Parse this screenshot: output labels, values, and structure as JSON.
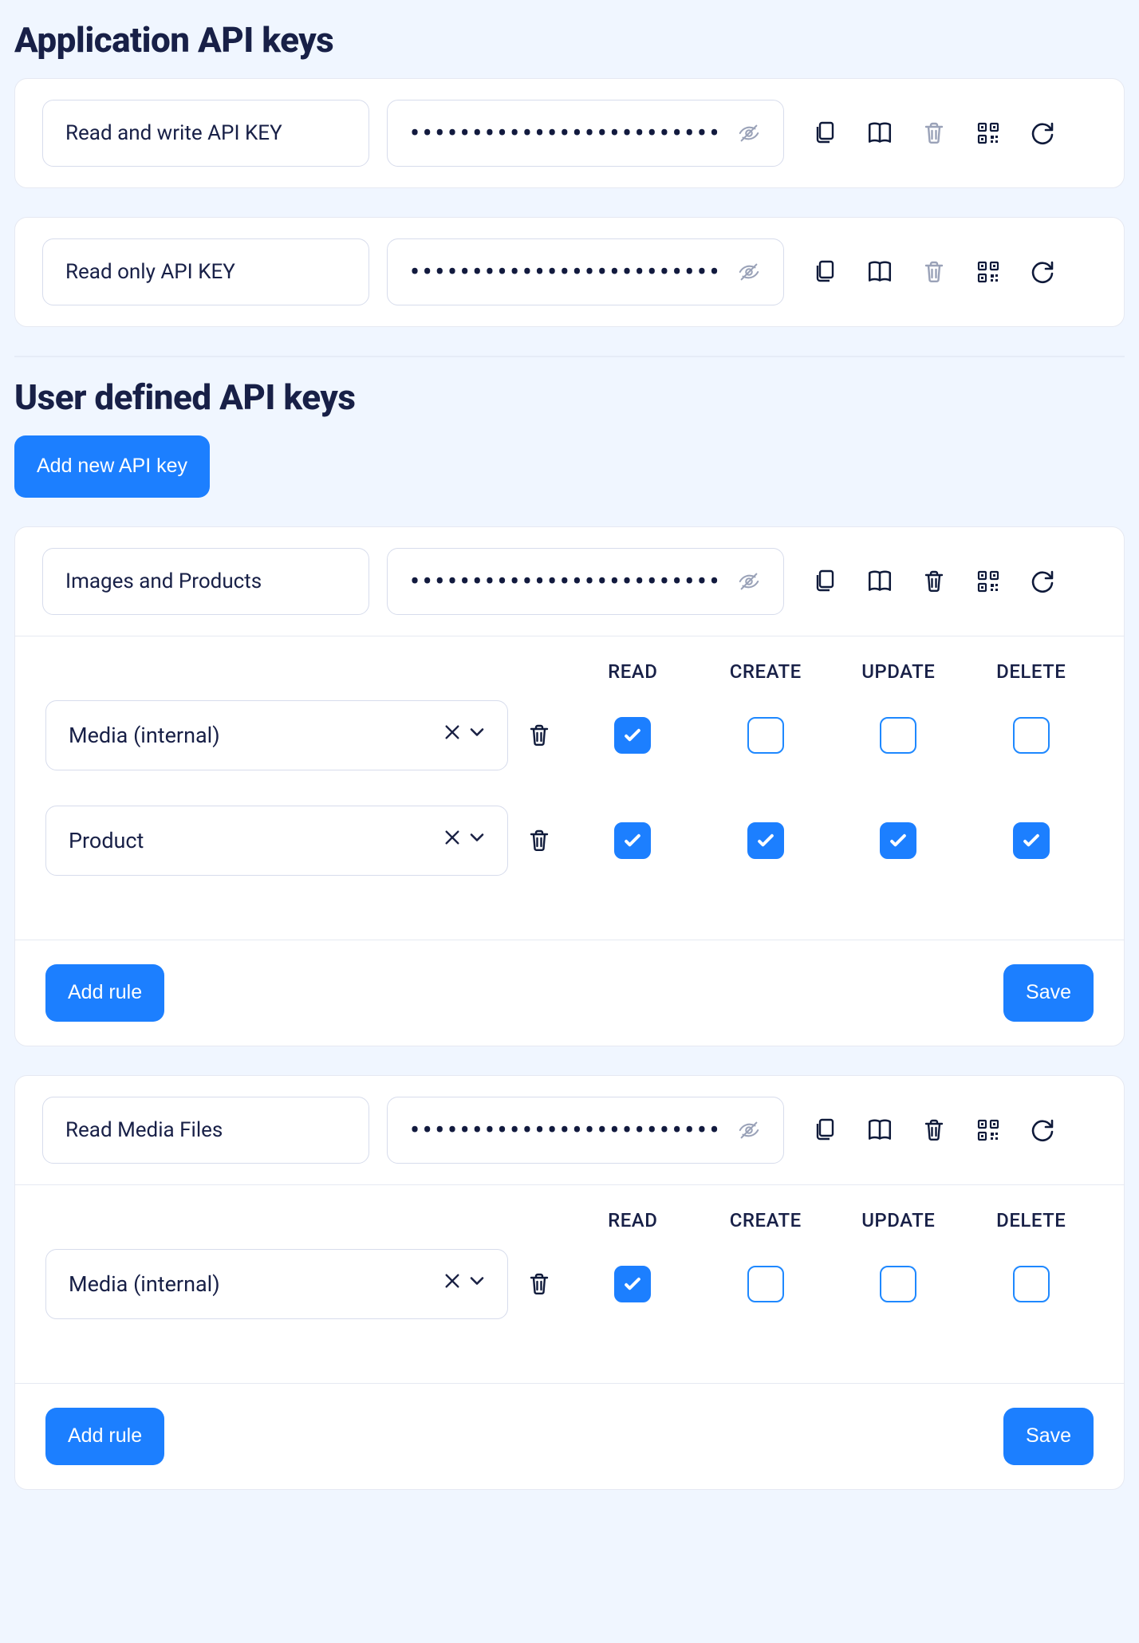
{
  "sections": {
    "application_title": "Application API keys",
    "user_title": "User defined API keys"
  },
  "buttons": {
    "add_api_key": "Add new API key",
    "add_rule": "Add rule",
    "save": "Save"
  },
  "key_mask": "•••••••••••••••••••••••••",
  "permission_headers": [
    "READ",
    "CREATE",
    "UPDATE",
    "DELETE"
  ],
  "app_keys": [
    {
      "name": "Read and write API KEY",
      "delete_enabled": false
    },
    {
      "name": "Read only API KEY",
      "delete_enabled": false
    }
  ],
  "user_keys": [
    {
      "name": "Images and Products",
      "delete_enabled": true,
      "rules": [
        {
          "target": "Media (internal)",
          "read": true,
          "create": false,
          "update": false,
          "delete": false
        },
        {
          "target": "Product",
          "read": true,
          "create": true,
          "update": true,
          "delete": true
        }
      ]
    },
    {
      "name": "Read Media Files",
      "delete_enabled": true,
      "rules": [
        {
          "target": "Media (internal)",
          "read": true,
          "create": false,
          "update": false,
          "delete": false
        }
      ]
    }
  ]
}
